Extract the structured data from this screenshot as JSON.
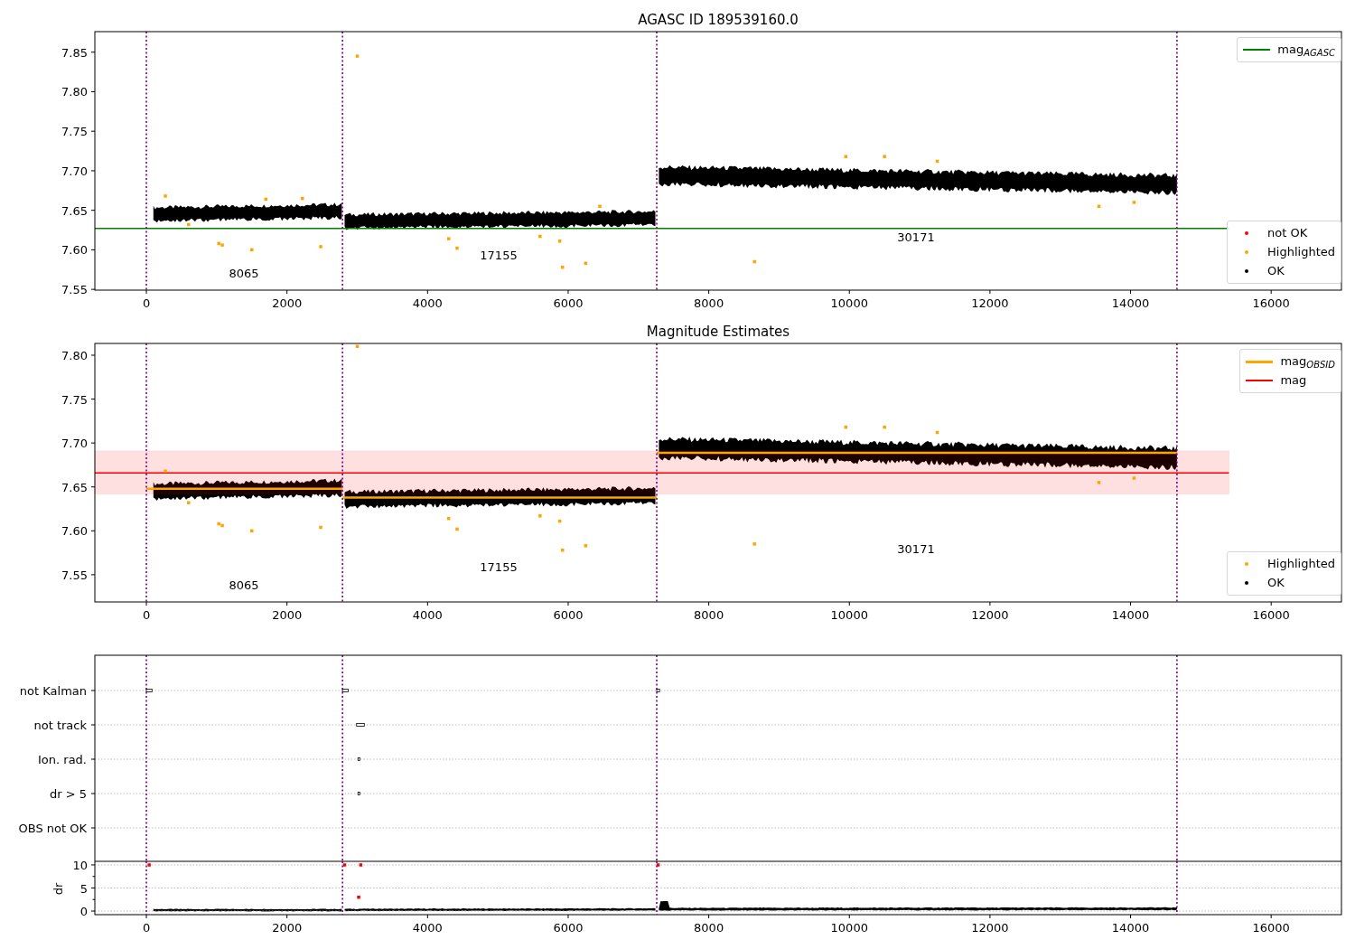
{
  "panels": [
    {
      "chart_data": {
        "type": "scatter",
        "title": "AGASC ID 189539160.0",
        "xlim": [
          -733,
          17000
        ],
        "ylim": [
          7.549,
          7.876
        ],
        "xticks": [
          0,
          2000,
          4000,
          6000,
          8000,
          10000,
          12000,
          14000,
          16000
        ],
        "yticks": [
          {
            "value": 7.55,
            "label": "7.55"
          },
          {
            "value": 7.6,
            "label": "7.60"
          },
          {
            "value": 7.65,
            "label": "7.65"
          },
          {
            "value": 7.7,
            "label": "7.70"
          },
          {
            "value": 7.75,
            "label": "7.75"
          },
          {
            "value": 7.8,
            "label": "7.80"
          },
          {
            "value": 7.85,
            "label": "7.85"
          }
        ],
        "series": [
          {
            "name": "mag$_{AGASC}$",
            "type": "line",
            "color": "#008000",
            "x": [
              -733,
              15400
            ],
            "values": [
              7.627,
              7.627
            ]
          },
          {
            "name": "Highlighted",
            "color": "#ffa500",
            "x": [
              3000,
              8650,
              5920,
              6250,
              1500,
              1030,
              1080,
              2480,
              4300,
              4420,
              5600,
              5880,
              1700,
              2220,
              9950,
              10500,
              11250,
              6450,
              270,
              600,
              13550,
              14050
            ],
            "values": [
              7.845,
              7.585,
              7.578,
              7.583,
              7.6,
              7.608,
              7.606,
              7.604,
              7.614,
              7.602,
              7.617,
              7.611,
              7.664,
              7.665,
              7.718,
              7.718,
              7.712,
              7.655,
              7.668,
              7.632,
              7.655,
              7.66
            ]
          }
        ],
        "ref_lines": [
          {
            "axis": "x",
            "value": 0
          },
          {
            "axis": "x",
            "value": 2790
          },
          {
            "axis": "x",
            "value": 7260
          },
          {
            "axis": "x",
            "value": 14660
          }
        ]
      },
      "legend_extras": [
        {
          "label": "not OK",
          "color": "#ff0000",
          "kind": "leading"
        },
        {
          "label": "OK",
          "color": "#000000",
          "kind": "trailing"
        }
      ],
      "obsid_labels": [
        "8065",
        "17155",
        "30171"
      ]
    },
    {
      "chart_data": {
        "type": "scatter",
        "title": "Magnitude Estimates",
        "xlim": [
          -733,
          17000
        ],
        "ylim": [
          7.519,
          7.8134
        ],
        "xticks": [
          0,
          2000,
          4000,
          6000,
          8000,
          10000,
          12000,
          14000,
          16000
        ],
        "yticks": [
          {
            "value": 7.55,
            "label": "7.55"
          },
          {
            "value": 7.6,
            "label": "7.60"
          },
          {
            "value": 7.65,
            "label": "7.65"
          },
          {
            "value": 7.7,
            "label": "7.70"
          },
          {
            "value": 7.75,
            "label": "7.75"
          },
          {
            "value": 7.8,
            "label": "7.80"
          }
        ],
        "series": [
          {
            "name": "mag$_{OBSID}$",
            "type": "line",
            "color": "#ffa500",
            "x": [
              0,
              2790,
              null,
              2790,
              7260,
              null,
              7260,
              14660
            ],
            "values": [
              7.648,
              7.648,
              null,
              7.638,
              7.638,
              null,
              7.689,
              7.689
            ]
          },
          {
            "name": "mag",
            "type": "line",
            "color": "#ff0000",
            "x": [
              -733,
              15400
            ],
            "values": [
              7.666,
              7.666
            ]
          },
          {
            "name": "Highlighted",
            "color": "#ffa500",
            "x": [
              3000,
              8650,
              5920,
              6250,
              1500,
              1030,
              1080,
              2480,
              4300,
              4420,
              5600,
              5880,
              9950,
              10500,
              11250,
              270,
              600,
              13550,
              14050
            ],
            "values": [
              7.81,
              7.585,
              7.578,
              7.583,
              7.6,
              7.608,
              7.606,
              7.604,
              7.614,
              7.602,
              7.617,
              7.611,
              7.718,
              7.718,
              7.712,
              7.668,
              7.632,
              7.655,
              7.66
            ]
          }
        ],
        "bands": [
          {
            "axis": "y",
            "from": 7.642,
            "to": 7.691
          }
        ],
        "ref_lines": [
          {
            "axis": "x",
            "value": 0
          },
          {
            "axis": "x",
            "value": 2790
          },
          {
            "axis": "x",
            "value": 7260
          },
          {
            "axis": "x",
            "value": 14660
          }
        ]
      },
      "legend_extras": [
        {
          "label": "OK",
          "color": "#000000",
          "kind": "trailing"
        }
      ],
      "obsid_labels": [
        "8065",
        "17155",
        "30171"
      ]
    },
    {
      "flag_rows": [
        {
          "label": "not Kalman"
        },
        {
          "label": "not track"
        },
        {
          "label": "Ion. rad."
        },
        {
          "label": "dr > 5"
        },
        {
          "label": "OBS not OK"
        }
      ]
    },
    {
      "chart_data": {
        "type": "scatter",
        "ylabel": "dr",
        "xlim": [
          -733,
          17000
        ],
        "ylim": [
          -0.78,
          10.78
        ],
        "grid": true,
        "xticks": [
          0,
          2000,
          4000,
          6000,
          8000,
          10000,
          12000,
          14000,
          16000
        ],
        "yticks": [
          0,
          5,
          10
        ],
        "series": [
          {
            "color": "#ff0000",
            "x": [
              40,
              2820,
              3050,
              7280,
              3020
            ],
            "values": [
              10,
              10,
              10,
              10,
              3
            ]
          }
        ],
        "ref_lines": [
          {
            "axis": "x",
            "value": 0
          },
          {
            "axis": "x",
            "value": 2790
          },
          {
            "axis": "x",
            "value": 7260
          },
          {
            "axis": "x",
            "value": 14660
          }
        ]
      }
    }
  ]
}
